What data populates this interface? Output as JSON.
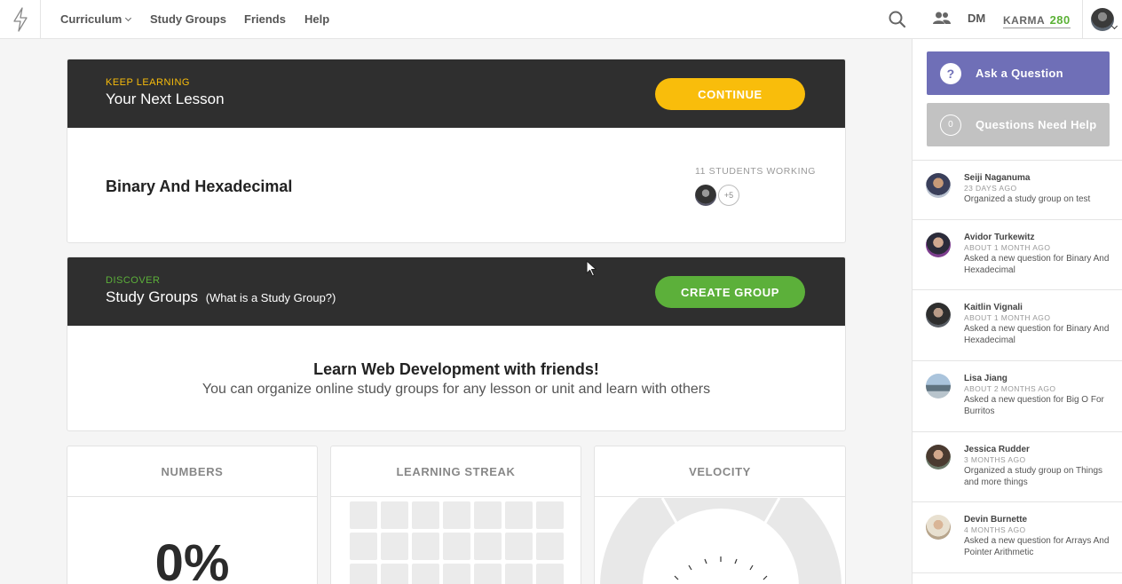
{
  "nav": {
    "links": [
      "Curriculum",
      "Study Groups",
      "Friends",
      "Help"
    ],
    "user_initials": "DM",
    "karma_label": "KARMA",
    "karma_value": "280"
  },
  "next_lesson": {
    "kicker": "KEEP LEARNING",
    "title": "Your Next Lesson",
    "button": "CONTINUE",
    "lesson_name": "Binary And Hexadecimal",
    "students_working": "11 STUDENTS WORKING",
    "more_count": "+5"
  },
  "study_groups": {
    "kicker": "DISCOVER",
    "title": "Study Groups",
    "title_link": "(What is a Study Group?)",
    "button": "CREATE GROUP",
    "promo_title": "Learn Web Development with friends!",
    "promo_sub": "You can organize online study groups for any lesson or unit and learn with others"
  },
  "stats": {
    "numbers_label": "NUMBERS",
    "numbers_value": "0%",
    "streak_label": "LEARNING STREAK",
    "velocity_label": "VELOCITY"
  },
  "sidebar": {
    "ask_label": "Ask a Question",
    "ask_icon": "?",
    "help_label": "Questions Need Help",
    "help_count": "0",
    "activity": [
      {
        "name": "Seiji Naganuma",
        "time": "23 DAYS AGO",
        "text": "Organized a study group on test"
      },
      {
        "name": "Avidor Turkewitz",
        "time": "ABOUT 1 MONTH AGO",
        "text": "Asked a new question for Binary And Hexadecimal"
      },
      {
        "name": "Kaitlin Vignali",
        "time": "ABOUT 1 MONTH AGO",
        "text": "Asked a new question for Binary And Hexadecimal"
      },
      {
        "name": "Lisa Jiang",
        "time": "ABOUT 2 MONTHS AGO",
        "text": "Asked a new question for Big O For Burritos"
      },
      {
        "name": "Jessica Rudder",
        "time": "3 MONTHS AGO",
        "text": "Organized a study group on Things and more things"
      },
      {
        "name": "Devin Burnette",
        "time": "4 MONTHS AGO",
        "text": "Asked a new question for Arrays And Pointer Arithmetic"
      }
    ]
  },
  "colors": {
    "accent_yellow": "#f9bd0b",
    "accent_green": "#5cb03a",
    "accent_purple": "#6f6fb7",
    "header_dark": "#2f2f2f"
  }
}
